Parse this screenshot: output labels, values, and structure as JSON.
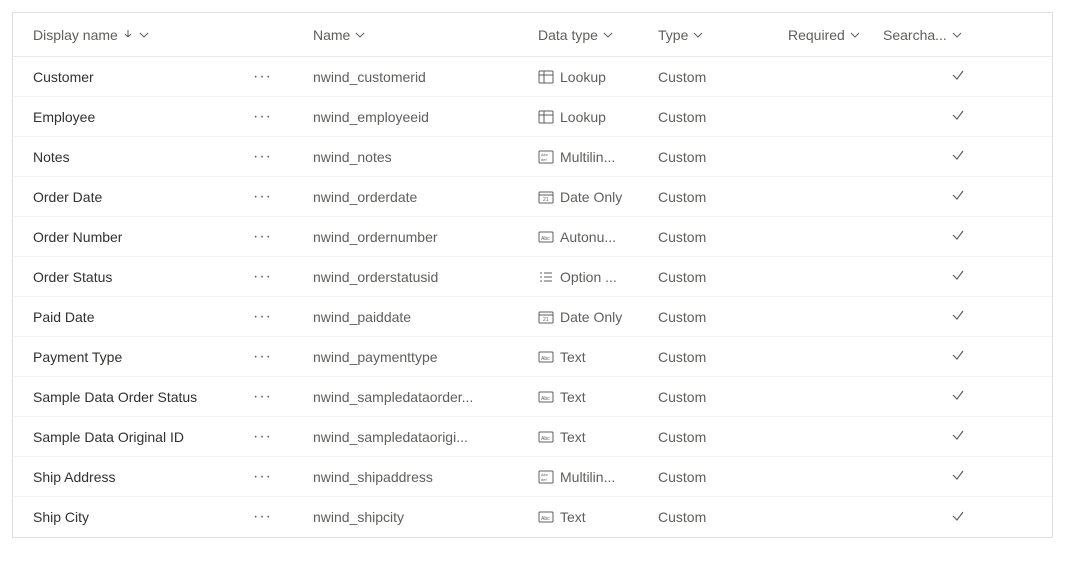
{
  "headers": {
    "display_name": "Display name",
    "name": "Name",
    "data_type": "Data type",
    "type": "Type",
    "required": "Required",
    "searchable": "Searcha..."
  },
  "rows": [
    {
      "display": "Customer",
      "name": "nwind_customerid",
      "datatype": "Lookup",
      "datatype_icon": "lookup",
      "type": "Custom",
      "required": "",
      "searchable": true
    },
    {
      "display": "Employee",
      "name": "nwind_employeeid",
      "datatype": "Lookup",
      "datatype_icon": "lookup",
      "type": "Custom",
      "required": "",
      "searchable": true
    },
    {
      "display": "Notes",
      "name": "nwind_notes",
      "datatype": "Multilin...",
      "datatype_icon": "multiline",
      "type": "Custom",
      "required": "",
      "searchable": true
    },
    {
      "display": "Order Date",
      "name": "nwind_orderdate",
      "datatype": "Date Only",
      "datatype_icon": "date",
      "type": "Custom",
      "required": "",
      "searchable": true
    },
    {
      "display": "Order Number",
      "name": "nwind_ordernumber",
      "datatype": "Autonu...",
      "datatype_icon": "autonumber",
      "type": "Custom",
      "required": "",
      "searchable": true
    },
    {
      "display": "Order Status",
      "name": "nwind_orderstatusid",
      "datatype": "Option ...",
      "datatype_icon": "optionset",
      "type": "Custom",
      "required": "",
      "searchable": true
    },
    {
      "display": "Paid Date",
      "name": "nwind_paiddate",
      "datatype": "Date Only",
      "datatype_icon": "date",
      "type": "Custom",
      "required": "",
      "searchable": true
    },
    {
      "display": "Payment Type",
      "name": "nwind_paymenttype",
      "datatype": "Text",
      "datatype_icon": "text",
      "type": "Custom",
      "required": "",
      "searchable": true
    },
    {
      "display": "Sample Data Order Status",
      "name": "nwind_sampledataorder...",
      "datatype": "Text",
      "datatype_icon": "text",
      "type": "Custom",
      "required": "",
      "searchable": true
    },
    {
      "display": "Sample Data Original ID",
      "name": "nwind_sampledataorigi...",
      "datatype": "Text",
      "datatype_icon": "text",
      "type": "Custom",
      "required": "",
      "searchable": true
    },
    {
      "display": "Ship Address",
      "name": "nwind_shipaddress",
      "datatype": "Multilin...",
      "datatype_icon": "multiline",
      "type": "Custom",
      "required": "",
      "searchable": true
    },
    {
      "display": "Ship City",
      "name": "nwind_shipcity",
      "datatype": "Text",
      "datatype_icon": "text",
      "type": "Custom",
      "required": "",
      "searchable": true
    }
  ],
  "ellipsis_label": "···"
}
